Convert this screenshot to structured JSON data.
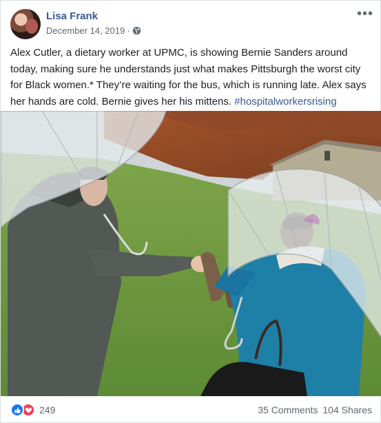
{
  "post": {
    "author": "Lisa Frank",
    "date": "December 14, 2019",
    "date_separator": "·",
    "privacy_icon": "globe-icon",
    "more_icon": "more-options-icon",
    "text": "Alex Cutler, a dietary worker at UPMC, is showing Bernie Sanders around today, making sure he understands just what makes Pittsburgh the worst city for Black women.* They’re waiting for the bus, which is running late. Alex says her hands are cold. Bernie gives her his mittens. ",
    "hashtag": "#hospitalworkersrising"
  },
  "footer": {
    "reaction_icons": [
      "like-icon",
      "love-icon"
    ],
    "reaction_count": "249",
    "comments": "35 Comments",
    "shares": "104 Shares"
  },
  "colors": {
    "link": "#385898",
    "meta": "#606770",
    "like": "#1877f2",
    "love": "#f33e58"
  }
}
